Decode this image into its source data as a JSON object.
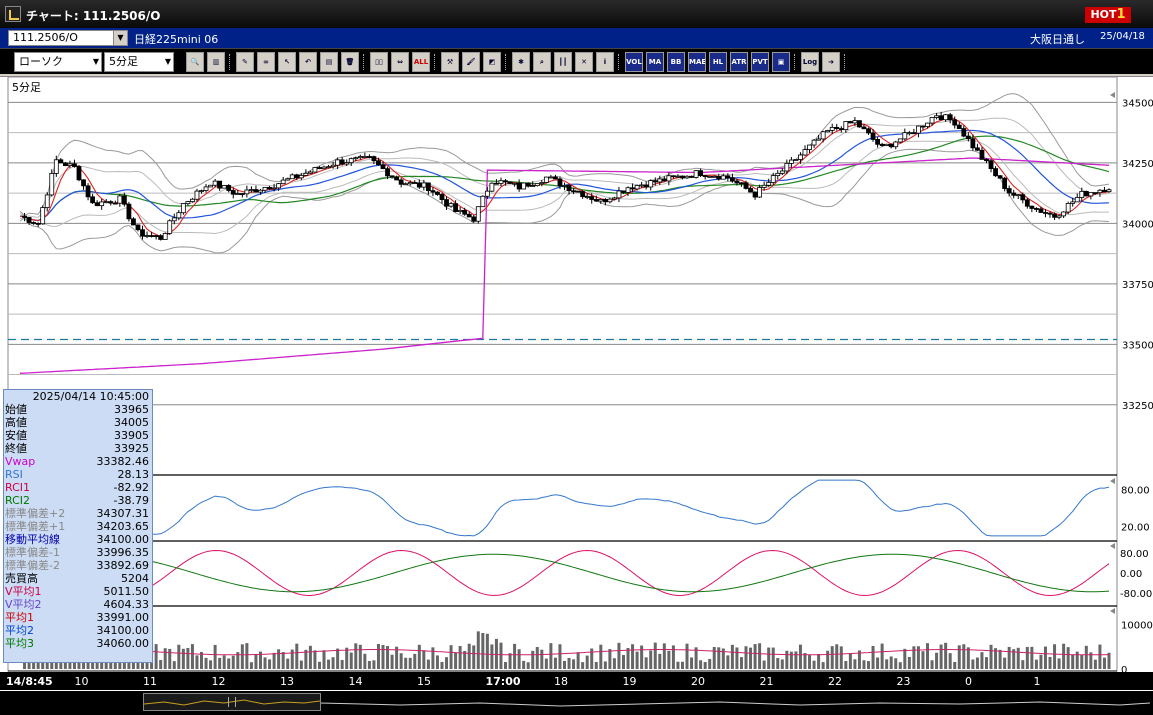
{
  "title": "チャート: 111.2506/O",
  "hot": {
    "label": "HOT",
    "num": "1"
  },
  "header": {
    "symbol": "111.2506/O",
    "instrument": "日経225mini 06",
    "session": "大阪日通し",
    "date": "25/04/18"
  },
  "toolbar": {
    "chart_type": "ローソク",
    "interval": "5分足",
    "buttons": [
      {
        "name": "zoom-icon",
        "glyph": "🔍",
        "style": ""
      },
      {
        "name": "grid-icon",
        "glyph": "▥",
        "style": ""
      },
      {
        "name": "pen-icon",
        "glyph": "✎",
        "style": ""
      },
      {
        "name": "link-icon",
        "glyph": "∞",
        "style": ""
      },
      {
        "name": "cursor-icon",
        "glyph": "↖",
        "style": ""
      },
      {
        "name": "undo-icon",
        "glyph": "↶",
        "style": ""
      },
      {
        "name": "document-icon",
        "glyph": "▤",
        "style": ""
      },
      {
        "name": "trash-icon",
        "glyph": "🗑",
        "style": ""
      },
      {
        "name": "bars-icon",
        "glyph": "▯▯",
        "style": ""
      },
      {
        "name": "shift-icon",
        "glyph": "⇔",
        "style": ""
      },
      {
        "name": "all-button",
        "glyph": "ALL",
        "style": "red"
      },
      {
        "name": "tools-icon",
        "glyph": "⚒",
        "style": ""
      },
      {
        "name": "brush-icon",
        "glyph": "🖌",
        "style": ""
      },
      {
        "name": "color-icon",
        "glyph": "◩",
        "style": ""
      },
      {
        "name": "stamp-icon",
        "glyph": "✱",
        "style": ""
      },
      {
        "name": "search-chart-icon",
        "glyph": "⌕",
        "style": ""
      },
      {
        "name": "candle-icon",
        "glyph": "┃┃",
        "style": ""
      },
      {
        "name": "mark-icon",
        "glyph": "✕",
        "style": ""
      },
      {
        "name": "info-icon",
        "glyph": "i",
        "style": ""
      },
      {
        "name": "vol-icon",
        "glyph": "VOL",
        "style": "blue"
      },
      {
        "name": "ma-button",
        "glyph": "MA",
        "style": "blue"
      },
      {
        "name": "bb-button",
        "glyph": "BB",
        "style": "blue"
      },
      {
        "name": "mae-button",
        "glyph": "MAE",
        "style": "blue"
      },
      {
        "name": "hl-button",
        "glyph": "HL",
        "style": "blue"
      },
      {
        "name": "atr-button",
        "glyph": "ATR",
        "style": "blue"
      },
      {
        "name": "pvt-button",
        "glyph": "PVT",
        "style": "blue"
      },
      {
        "name": "frame-icon",
        "glyph": "▣",
        "style": "blue"
      },
      {
        "name": "log-button",
        "glyph": "Log",
        "style": ""
      },
      {
        "name": "export-icon",
        "glyph": "➜",
        "style": ""
      }
    ]
  },
  "chart_data": {
    "type": "candlestick",
    "title": "5分足",
    "price_axis": {
      "ticks": [
        34500,
        34250,
        34000,
        33750,
        33500,
        33250
      ],
      "range": [
        33150,
        34580
      ]
    },
    "time_axis_labels": [
      "14/8:45",
      "10",
      "11",
      "12",
      "13",
      "14",
      "15",
      "17:00",
      "18",
      "19",
      "20",
      "21",
      "22",
      "23",
      "0",
      "1"
    ],
    "rsi_panel": {
      "ticks": [
        "80.00",
        "20.00"
      ]
    },
    "rci_panel": {
      "ticks": [
        "80.00",
        "0.00",
        "-80.00"
      ]
    },
    "volume_panel": {
      "ticks": [
        "10000",
        "0"
      ]
    },
    "dashed_level": 33520,
    "price_path": [
      {
        "i": 0,
        "p": 34030
      },
      {
        "i": 4,
        "p": 34000
      },
      {
        "i": 8,
        "p": 34260
      },
      {
        "i": 12,
        "p": 34230
      },
      {
        "i": 16,
        "p": 34080
      },
      {
        "i": 22,
        "p": 34100
      },
      {
        "i": 26,
        "p": 33960
      },
      {
        "i": 31,
        "p": 33940
      },
      {
        "i": 36,
        "p": 34080
      },
      {
        "i": 42,
        "p": 34170
      },
      {
        "i": 48,
        "p": 34120
      },
      {
        "i": 56,
        "p": 34160
      },
      {
        "i": 62,
        "p": 34200
      },
      {
        "i": 70,
        "p": 34255
      },
      {
        "i": 77,
        "p": 34265
      },
      {
        "i": 84,
        "p": 34170
      },
      {
        "i": 90,
        "p": 34150
      },
      {
        "i": 96,
        "p": 34050
      },
      {
        "i": 100,
        "p": 34020
      },
      {
        "i": 104,
        "p": 34180
      },
      {
        "i": 110,
        "p": 34150
      },
      {
        "i": 116,
        "p": 34190
      },
      {
        "i": 122,
        "p": 34140
      },
      {
        "i": 128,
        "p": 34090
      },
      {
        "i": 134,
        "p": 34150
      },
      {
        "i": 142,
        "p": 34180
      },
      {
        "i": 150,
        "p": 34210
      },
      {
        "i": 156,
        "p": 34190
      },
      {
        "i": 162,
        "p": 34120
      },
      {
        "i": 170,
        "p": 34250
      },
      {
        "i": 178,
        "p": 34380
      },
      {
        "i": 184,
        "p": 34420
      },
      {
        "i": 190,
        "p": 34310
      },
      {
        "i": 196,
        "p": 34370
      },
      {
        "i": 202,
        "p": 34450
      },
      {
        "i": 206,
        "p": 34420
      },
      {
        "i": 212,
        "p": 34270
      },
      {
        "i": 218,
        "p": 34130
      },
      {
        "i": 224,
        "p": 34060
      },
      {
        "i": 228,
        "p": 34030
      },
      {
        "i": 234,
        "p": 34120
      },
      {
        "i": 240,
        "p": 34150
      }
    ],
    "vwap_path": [
      {
        "i": 0,
        "p": 33380
      },
      {
        "i": 40,
        "p": 33420
      },
      {
        "i": 80,
        "p": 33480
      },
      {
        "i": 102,
        "p": 33525
      },
      {
        "i": 103,
        "p": 34220
      },
      {
        "i": 150,
        "p": 34210
      },
      {
        "i": 210,
        "p": 34270
      },
      {
        "i": 240,
        "p": 34240
      }
    ]
  },
  "data_panel": {
    "datetime": "2025/04/14 10:45:00",
    "rows": [
      {
        "label": "始値",
        "value": "33965",
        "color": "#000"
      },
      {
        "label": "高値",
        "value": "34005",
        "color": "#000"
      },
      {
        "label": "安値",
        "value": "33905",
        "color": "#000"
      },
      {
        "label": "終値",
        "value": "33925",
        "color": "#000"
      },
      {
        "label": "Vwap",
        "value": "33382.46",
        "color": "#cc00cc"
      },
      {
        "label": "RSI",
        "value": "28.13",
        "color": "#3377cc"
      },
      {
        "label": "RCI1",
        "value": "-82.92",
        "color": "#cc0044"
      },
      {
        "label": "RCI2",
        "value": "-38.79",
        "color": "#007700"
      },
      {
        "label": "標準偏差+2",
        "value": "34307.31",
        "color": "#888"
      },
      {
        "label": "標準偏差+1",
        "value": "34203.65",
        "color": "#888"
      },
      {
        "label": "移動平均線",
        "value": "34100.00",
        "color": "#0000aa"
      },
      {
        "label": "標準偏差-1",
        "value": "33996.35",
        "color": "#888"
      },
      {
        "label": "標準偏差-2",
        "value": "33892.69",
        "color": "#888"
      },
      {
        "label": "売買高",
        "value": "5204",
        "color": "#000"
      },
      {
        "label": "V平均1",
        "value": "5011.50",
        "color": "#cc0044"
      },
      {
        "label": "V平均2",
        "value": "4604.33",
        "color": "#6644cc"
      },
      {
        "label": "平均1",
        "value": "33991.00",
        "color": "#cc0000"
      },
      {
        "label": "平均2",
        "value": "34100.00",
        "color": "#0044cc"
      },
      {
        "label": "平均3",
        "value": "34060.00",
        "color": "#007700"
      }
    ]
  }
}
